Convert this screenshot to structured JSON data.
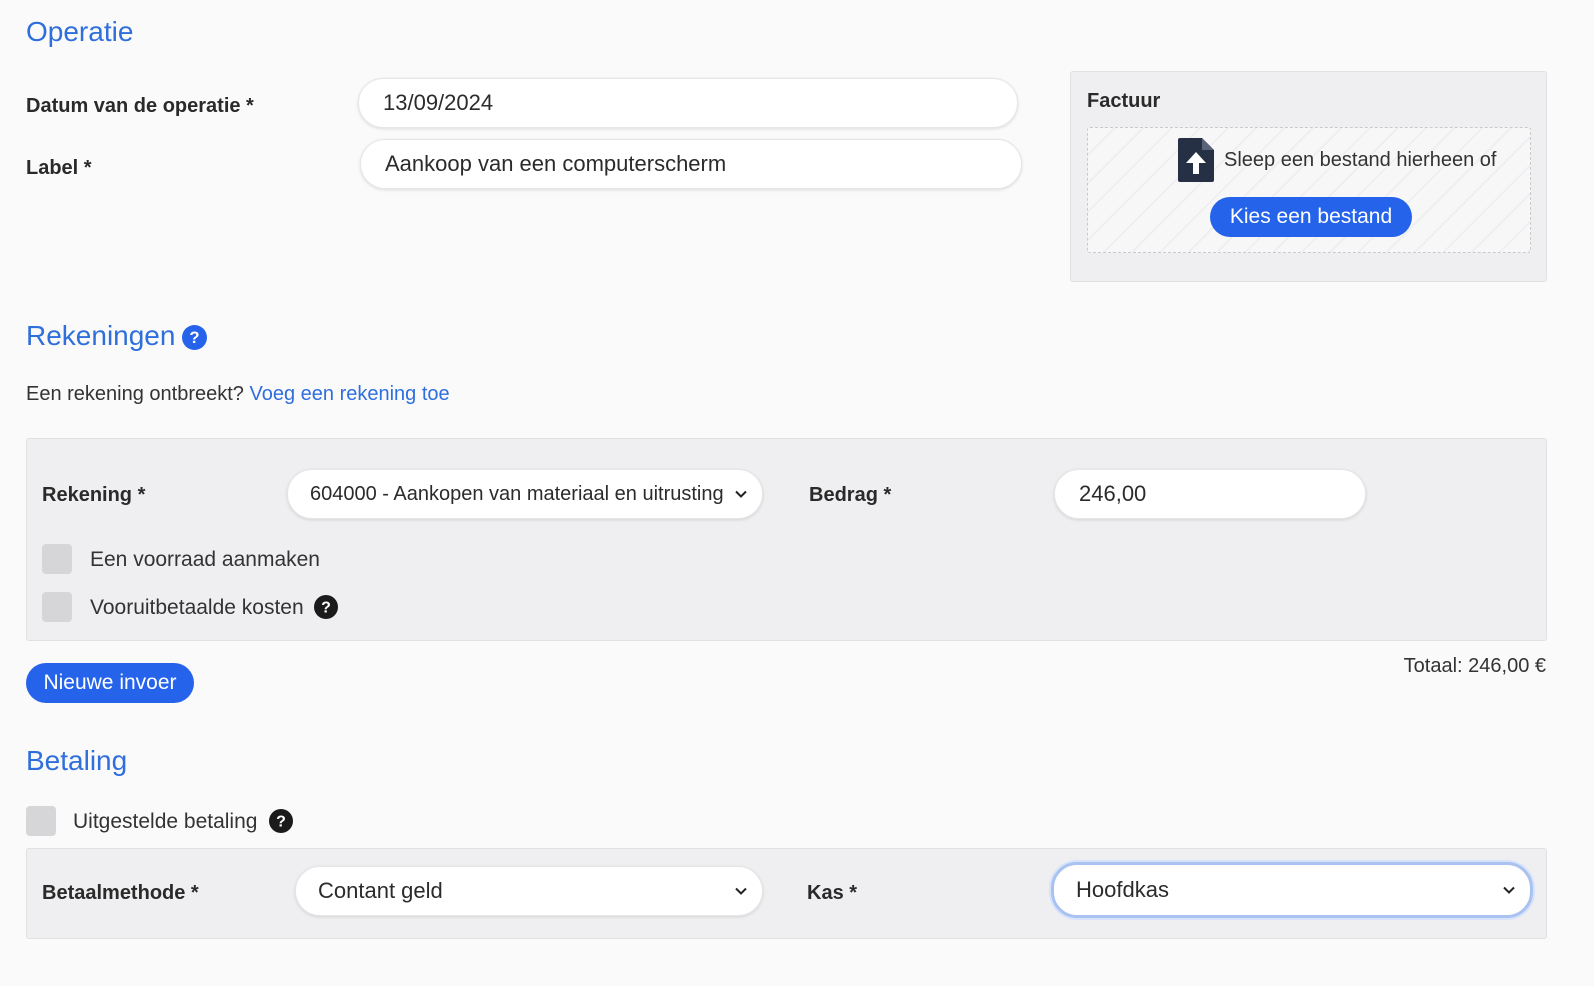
{
  "operatie": {
    "title": "Operatie",
    "date_label": "Datum van de operatie *",
    "date_value": "13/09/2024",
    "label_label": "Label *",
    "label_value": "Aankoop van een computerscherm"
  },
  "factuur": {
    "title": "Factuur",
    "drop_text": "Sleep een bestand hierheen of",
    "choose_button": "Kies een bestand",
    "icon": "file-upload-icon"
  },
  "rekeningen": {
    "title": "Rekeningen",
    "missing_text": "Een rekening ontbreekt?",
    "add_link": "Voeg een rekening toe",
    "account_label": "Rekening *",
    "account_value": "604000 - Aankopen van materiaal en uitrusting",
    "amount_label": "Bedrag *",
    "amount_value": "246,00",
    "stock_label": "Een voorraad aanmaken",
    "prepaid_label": "Vooruitbetaalde kosten",
    "new_entry_button": "Nieuwe invoer",
    "total": "Totaal: 246,00 €"
  },
  "betaling": {
    "title": "Betaling",
    "deferred_label": "Uitgestelde betaling",
    "method_label": "Betaalmethode *",
    "method_value": "Contant geld",
    "kas_label": "Kas *",
    "kas_value": "Hoofdkas"
  },
  "colors": {
    "accent": "#2f6fdc",
    "button": "#2563eb",
    "panel": "#efeff1"
  }
}
